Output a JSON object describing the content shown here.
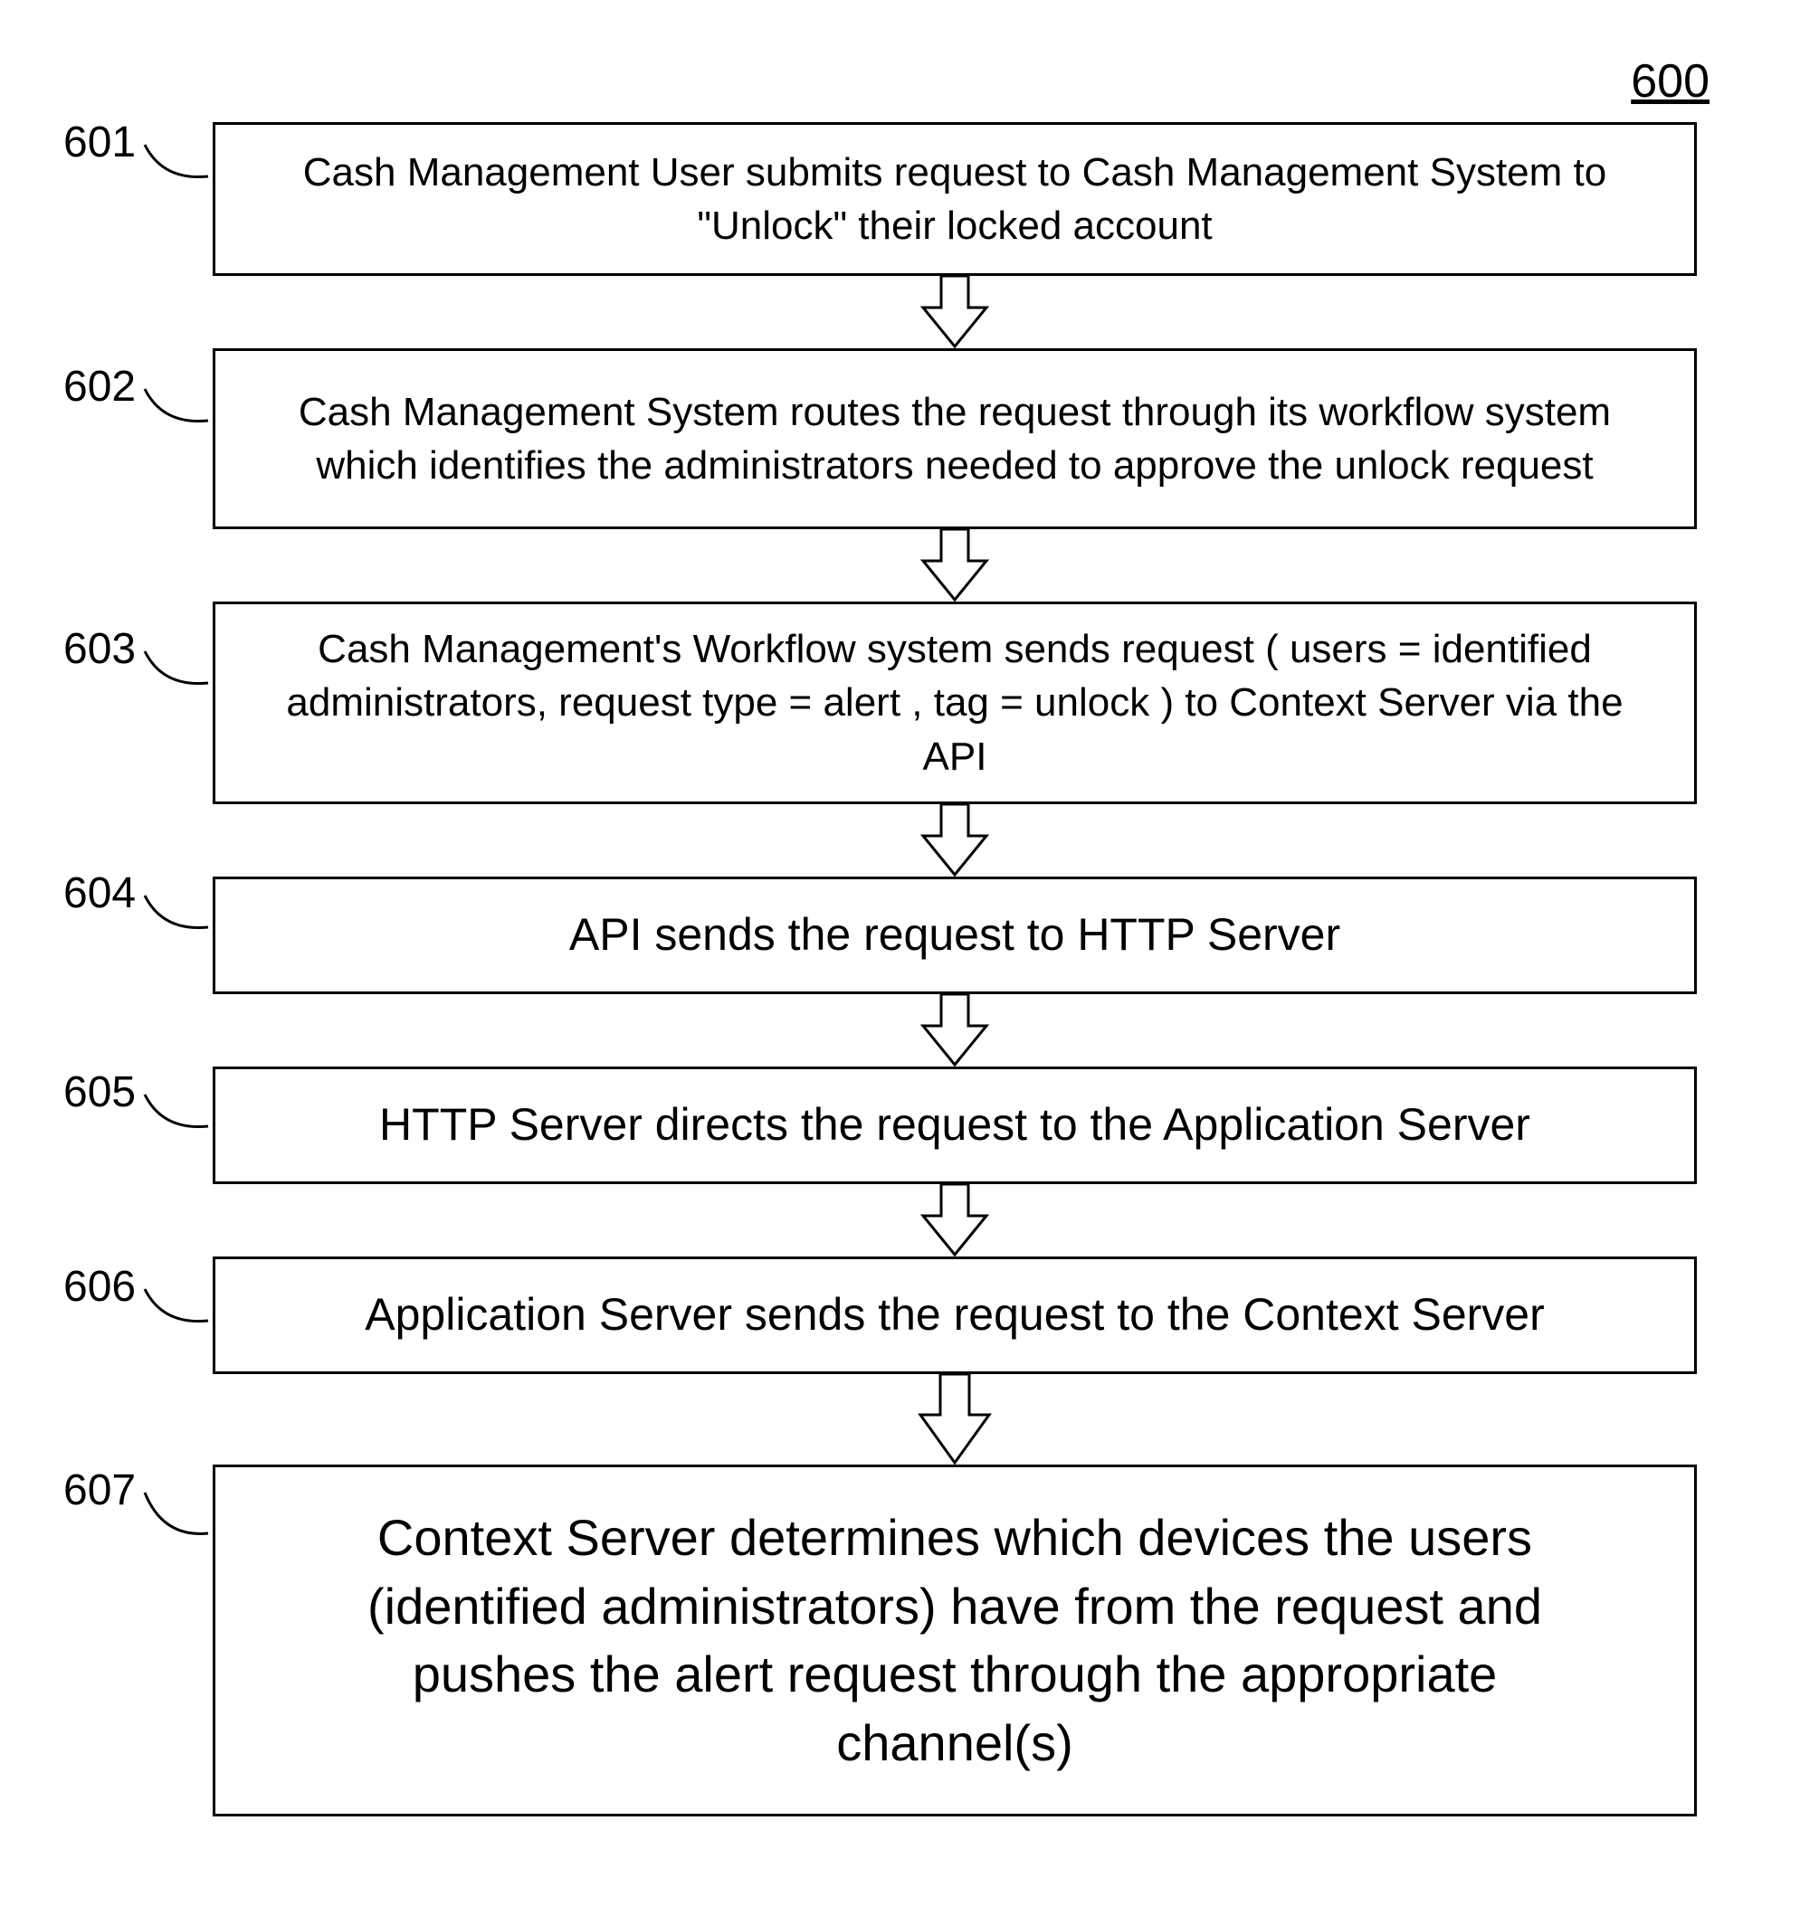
{
  "figure_number": "600",
  "steps": [
    {
      "label": "601",
      "text": "Cash Management User submits request to Cash Management System to \"Unlock\" their locked account"
    },
    {
      "label": "602",
      "text": "Cash Management System routes the request through its workflow system which identifies the administrators needed to approve the unlock request"
    },
    {
      "label": "603",
      "text": "Cash Management's Workflow system sends request ( users = identified administrators, request type = alert ,  tag = unlock ) to Context Server via the API"
    },
    {
      "label": "604",
      "text": "API sends the request to  HTTP Server"
    },
    {
      "label": "605",
      "text": "HTTP Server directs the request to the  Application Server"
    },
    {
      "label": "606",
      "text": "Application Server  sends the request to the Context Server"
    },
    {
      "label": "607",
      "text": "Context Server determines which devices the users (identified administrators) have from the request and pushes  the alert request through the appropriate channel(s)"
    }
  ]
}
